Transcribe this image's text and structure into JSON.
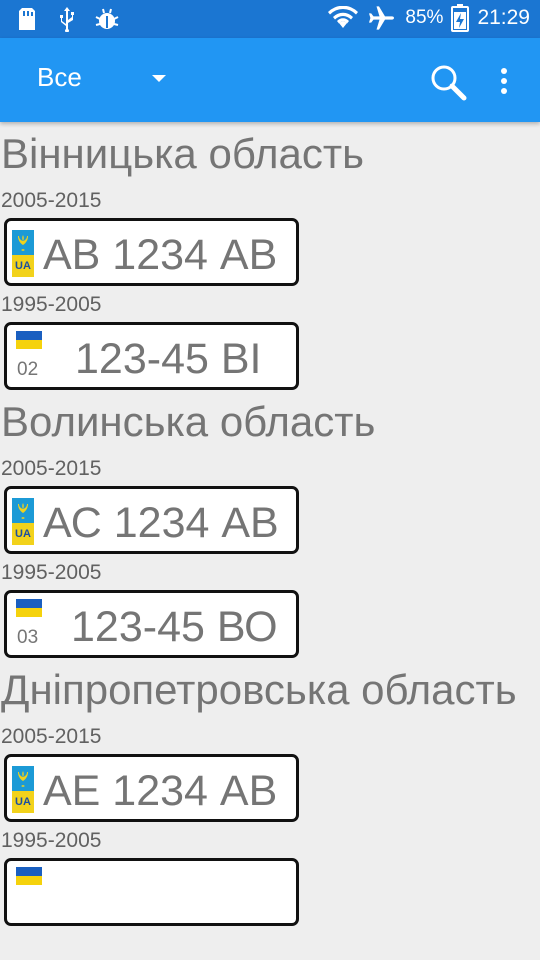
{
  "status_bar": {
    "battery_percent": "85%",
    "time": "21:29",
    "left_icons": [
      "sd-card-icon",
      "usb-icon",
      "android-debug-icon"
    ],
    "right_icons": [
      "wifi-icon",
      "airplane-mode-icon",
      "battery-charging-icon"
    ]
  },
  "app_bar": {
    "filter_selected": "Все",
    "actions": [
      "search-icon",
      "more-vert-icon"
    ]
  },
  "regions": [
    {
      "title": "Вінницька область",
      "plates": [
        {
          "period": "2005-2015",
          "style": "new",
          "badge": "UA",
          "text": "АВ 1234 АВ"
        },
        {
          "period": "1995-2005",
          "style": "old",
          "code": "02",
          "text": "123-45 ВІ"
        }
      ]
    },
    {
      "title": "Волинська область",
      "plates": [
        {
          "period": "2005-2015",
          "style": "new",
          "badge": "UA",
          "text": "АС 1234 АВ"
        },
        {
          "period": "1995-2005",
          "style": "old",
          "code": "03",
          "text": "123-45 ВО"
        }
      ]
    },
    {
      "title": "Дніпропетровська область",
      "plates": [
        {
          "period": "2005-2015",
          "style": "new",
          "badge": "UA",
          "text": "АЕ 1234 АВ"
        },
        {
          "period": "1995-2005",
          "style": "old",
          "code": "",
          "text": ""
        }
      ]
    }
  ],
  "colors": {
    "status_bar": "#1b76d2",
    "app_bar": "#2196f3",
    "background": "#eeeeee",
    "text_gray": "#757575",
    "ua_blue": "#1c9ad6",
    "ua_yellow": "#f2d21b"
  }
}
